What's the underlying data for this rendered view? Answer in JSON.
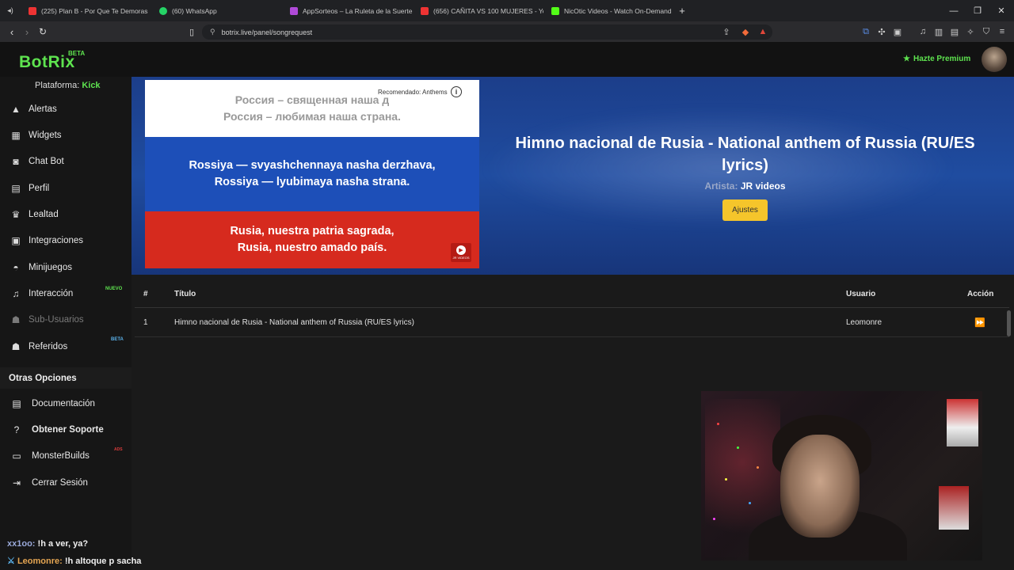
{
  "browser": {
    "tabs": [
      {
        "label": "(225) Plan B - Por Que Te Demoras",
        "fav_color": "#e33"
      },
      {
        "label": "(60) WhatsApp",
        "fav_color": "#25d366"
      },
      {
        "label": "AppSorteos – La Ruleta de la Suerte",
        "fav_color": "#b04ad8"
      },
      {
        "label": "(656) CAÑITA VS 100 MUJERES - YouTube",
        "fav_color": "#e33"
      },
      {
        "label": "NicOtic Videos - Watch On-Demand",
        "fav_color": "#53fc18"
      }
    ],
    "new_tab_label": "+",
    "url": "botrix.live/panel/songrequest"
  },
  "app": {
    "logo": "BotRix",
    "logo_badge": "BETA",
    "premium_label": "Hazte Premium",
    "accent_color": "#5ee34f"
  },
  "sidebar": {
    "platform_label": "Plataforma:",
    "platform_value": "Kick",
    "items": [
      {
        "label": "Alertas",
        "icon": "warning-icon"
      },
      {
        "label": "Widgets",
        "icon": "grid-icon"
      },
      {
        "label": "Chat Bot",
        "icon": "robot-icon"
      },
      {
        "label": "Perfil",
        "icon": "id-card-icon"
      },
      {
        "label": "Lealtad",
        "icon": "trophy-icon"
      },
      {
        "label": "Integraciones",
        "icon": "plug-icon"
      },
      {
        "label": "Minijuegos",
        "icon": "gamepad-icon"
      },
      {
        "label": "Interacción",
        "icon": "music-icon",
        "badge": "NUEVO"
      },
      {
        "label": "Sub-Usuarios",
        "icon": "users-icon",
        "disabled": true
      },
      {
        "label": "Referidos",
        "icon": "user-group-icon",
        "badge": "BETA"
      }
    ],
    "other_options_title": "Otras Opciones",
    "other_options": [
      {
        "label": "Documentación",
        "icon": "scroll-icon"
      },
      {
        "label": "Obtener Soporte",
        "icon": "question-icon"
      },
      {
        "label": "MonsterBuilds",
        "icon": "monitor-icon",
        "badge": "ADS"
      },
      {
        "label": "Cerrar Sesión",
        "icon": "logout-icon"
      }
    ]
  },
  "player": {
    "video_lines_russian": [
      "Россия – священная наша д",
      "Россия – любимая наша страна."
    ],
    "video_lines_translit": [
      "Rossiya — svyashchennaya nasha derzhava,",
      "Rossiya — lyubimaya nasha strana."
    ],
    "video_lines_spanish": [
      "Rusia, nuestra patria sagrada,",
      "Rusia, nuestro amado país."
    ],
    "recommended_label": "Recomendado: Anthems",
    "channel_badge": "JR VIDEOS",
    "song_title": "Himno nacional de Rusia - National anthem of Russia (RU/ES lyrics)",
    "artist_label": "Artista:",
    "artist_name": "JR videos",
    "settings_button": "Ajustes"
  },
  "queue": {
    "headers": {
      "num": "#",
      "title": "Título",
      "user": "Usuario",
      "action": "Acción"
    },
    "rows": [
      {
        "num": "1",
        "title": "Himno nacional de Rusia - National anthem of Russia (RU/ES lyrics)",
        "user": "Leomonre"
      }
    ]
  },
  "chat": [
    {
      "user": "xx1oo:",
      "message": "!h a ver, ya?"
    },
    {
      "user": "Leomonre:",
      "message": "!h altoque p sacha"
    }
  ]
}
